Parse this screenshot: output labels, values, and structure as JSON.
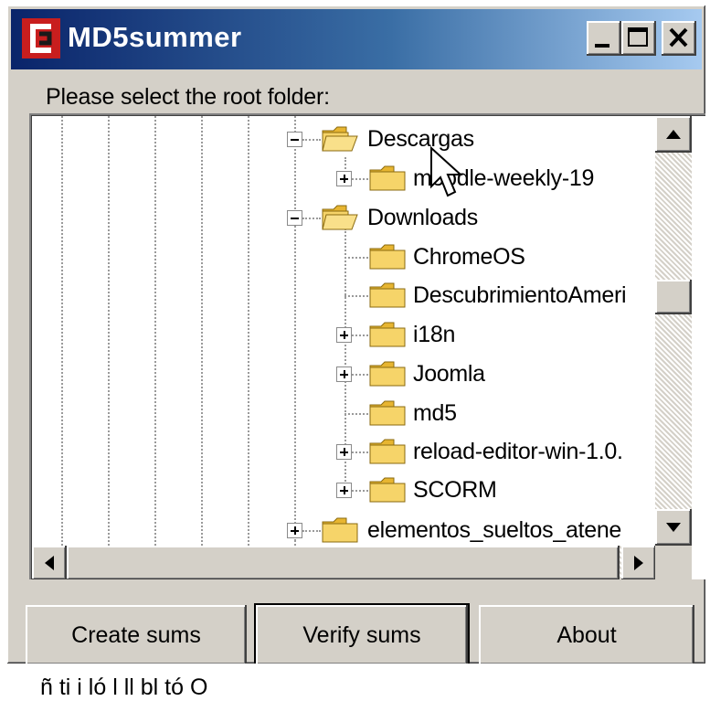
{
  "window": {
    "title": "MD5summer",
    "controls": [
      "minimize",
      "maximize",
      "close"
    ]
  },
  "prompt": "Please select the root folder:",
  "tree": {
    "items": [
      {
        "label": "Descargas",
        "expanded": true,
        "level": 0
      },
      {
        "label": "moodle-weekly-19",
        "expanded": false,
        "level": 1
      },
      {
        "label": "Downloads",
        "expanded": true,
        "level": 0
      },
      {
        "label": "ChromeOS",
        "level": 1
      },
      {
        "label": "DescubrimientoAmeri",
        "level": 1
      },
      {
        "label": "i18n",
        "expanded": false,
        "level": 1
      },
      {
        "label": "Joomla",
        "expanded": false,
        "level": 1
      },
      {
        "label": "md5",
        "level": 1
      },
      {
        "label": "reload-editor-win-1.0.",
        "expanded": false,
        "level": 1
      },
      {
        "label": "SCORM",
        "expanded": false,
        "level": 1
      },
      {
        "label": "elementos_sueltos_atene",
        "expanded": false,
        "level": 0
      }
    ],
    "vertical_scroll_position": 0.42
  },
  "buttons": {
    "create": "Create sums",
    "verify": "Verify sums",
    "about": "About"
  },
  "bottom_text": "ñ      ti  i ló   l               ll           bl  tó    O",
  "colors": {
    "title_start": "#0a246a",
    "title_end": "#a6caf0",
    "face": "#d4d0c8",
    "folder": "#f3c94a"
  }
}
